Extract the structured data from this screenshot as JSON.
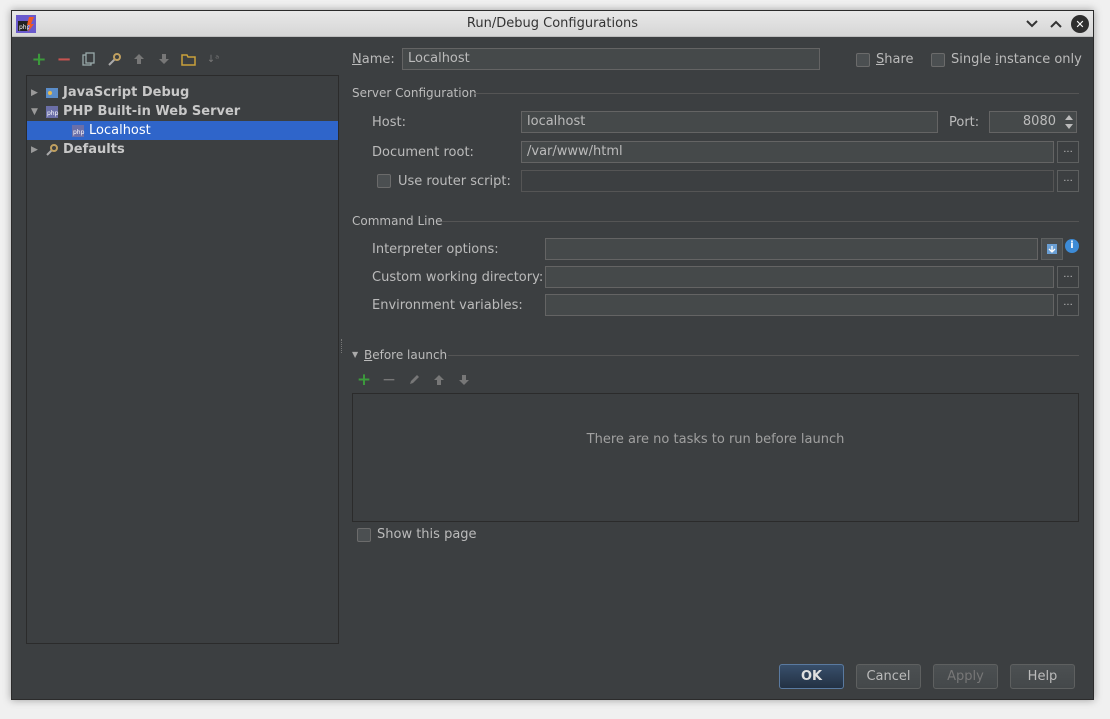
{
  "window": {
    "title": "Run/Debug Configurations"
  },
  "toolbar": {
    "icons": [
      "add-icon",
      "remove-icon",
      "copy-icon",
      "edit-defaults-icon",
      "move-up-icon",
      "move-down-icon",
      "folder-icon",
      "sort-icon"
    ]
  },
  "tree": {
    "items": [
      {
        "label": "JavaScript Debug",
        "expanded": false,
        "bold": true
      },
      {
        "label": "PHP Built-in Web Server",
        "expanded": true,
        "bold": true
      },
      {
        "label": "Localhost",
        "selected": true
      },
      {
        "label": "Defaults",
        "expanded": false,
        "bold": true
      }
    ]
  },
  "config": {
    "name_label_prefix": "N",
    "name_label_rest": "ame:",
    "name_value": "Localhost",
    "share_prefix": "S",
    "share_rest": "hare",
    "single_instance_pre": "Single ",
    "single_instance_u": "i",
    "single_instance_post": "nstance only"
  },
  "server": {
    "section_title": "Server Configuration",
    "host_label": "Host:",
    "host_value": "localhost",
    "port_label": "Port:",
    "port_value": "8080",
    "docroot_label": "Document root:",
    "docroot_value": "/var/www/html",
    "router_label": "Use router script:",
    "browse_label": "..."
  },
  "command": {
    "section_title": "Command Line",
    "interpreter_label": "Interpreter options:",
    "workdir_label": "Custom working directory:",
    "env_label": "Environment variables:",
    "info_glyph": "i"
  },
  "before_launch": {
    "title_u": "B",
    "title_rest": "efore launch",
    "empty_message": "There are no tasks to run before launch",
    "show_page_label": "Show this page"
  },
  "buttons": {
    "ok": "OK",
    "cancel": "Cancel",
    "apply": "Apply",
    "help": "Help"
  },
  "colors": {
    "background": "#3c3f41",
    "selection": "#2f65ca",
    "add_green": "#3c9a3c",
    "remove_red": "#c75450",
    "info_blue": "#3d8bd6"
  }
}
